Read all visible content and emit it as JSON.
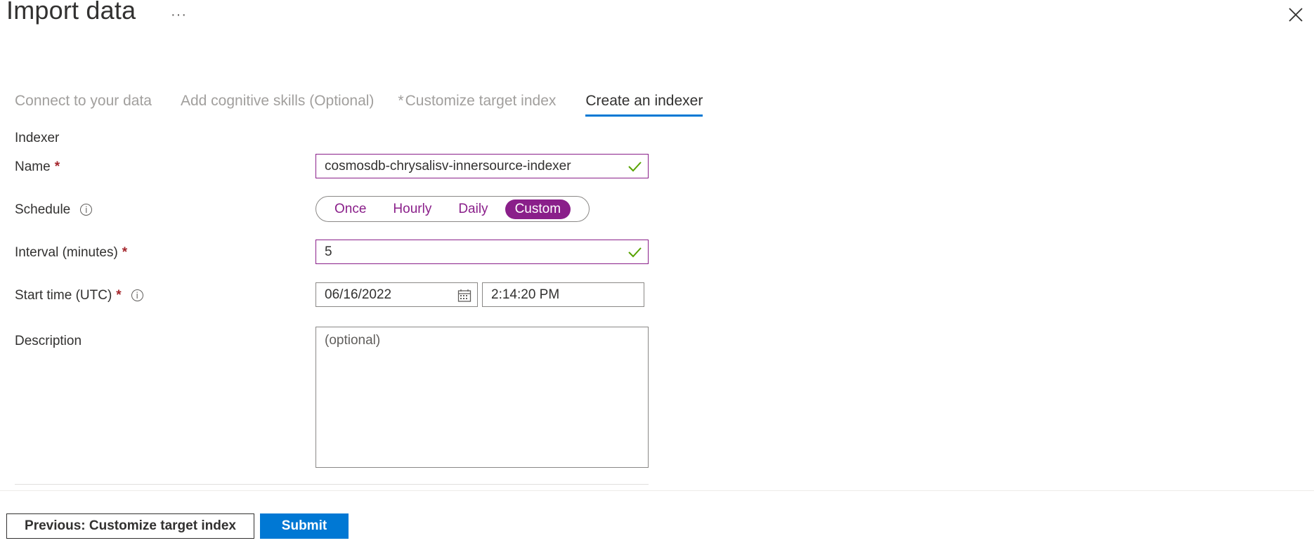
{
  "header": {
    "title": "Import data",
    "more_label": "···"
  },
  "tabs": [
    {
      "label": "Connect to your data",
      "required": false,
      "active": false
    },
    {
      "label": "Add cognitive skills (Optional)",
      "required": false,
      "active": false
    },
    {
      "label": "Customize target index",
      "required": true,
      "required_marker": "*",
      "active": false
    },
    {
      "label": "Create an indexer",
      "required": false,
      "active": true
    }
  ],
  "form": {
    "section_heading": "Indexer",
    "name": {
      "label": "Name",
      "required_marker": "*",
      "value": "cosmosdb-chrysalisv-innersource-indexer"
    },
    "schedule": {
      "label": "Schedule",
      "options": [
        "Once",
        "Hourly",
        "Daily",
        "Custom"
      ],
      "selected": "Custom"
    },
    "interval": {
      "label": "Interval (minutes)",
      "required_marker": "*",
      "value": "5"
    },
    "start_time": {
      "label": "Start time (UTC)",
      "required_marker": "*",
      "date": "06/16/2022",
      "time": "2:14:20 PM"
    },
    "description": {
      "label": "Description",
      "placeholder": "(optional)",
      "value": ""
    }
  },
  "footer": {
    "previous_label": "Previous: Customize target index",
    "submit_label": "Submit"
  },
  "colors": {
    "accent_purple": "#8a1f8a",
    "primary_blue": "#0078d4",
    "valid_green": "#57a300",
    "required_red": "#a4262c"
  }
}
